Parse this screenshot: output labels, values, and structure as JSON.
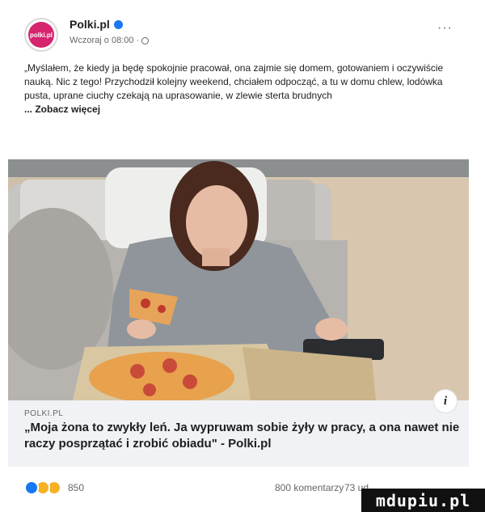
{
  "post": {
    "page_name": "Polki.pl",
    "avatar_text": "polki.pl",
    "timestamp": "Wczoraj o 08:00 ·",
    "more_label": "···",
    "text": "„Myślałem, że kiedy ja będę spokojnie pracował, ona zajmie się domem, gotowaniem i oczywiście nauką. Nic z tego! Przychodził kolejny weekend, chciałem odpocząć, a tu w domu chlew, lodówka pusta, uprane ciuchy czekają na uprasowanie, w zlewie sterta brudnych",
    "see_more": "... Zobacz więcej"
  },
  "link_card": {
    "domain": "POLKI.PL",
    "title": "„Moja żona to zwykły leń. Ja wypruwam sobie żyły w pracy, a ona nawet nie raczy posprzątać i zrobić obiadu\" - Polki.pl",
    "info_label": "i"
  },
  "reactions": {
    "count": "850",
    "comments": "800 komentarzy",
    "shares": "73 ud"
  },
  "watermark": {
    "text": "mdupiu.pl"
  },
  "colors": {
    "accent": "#1877f2",
    "brand": "#d6246e",
    "card_bg": "#f0f2f5"
  },
  "icons": [
    "verified-icon",
    "globe-icon",
    "more-icon",
    "info-icon",
    "like-reaction-icon",
    "wow-reaction-icon"
  ]
}
